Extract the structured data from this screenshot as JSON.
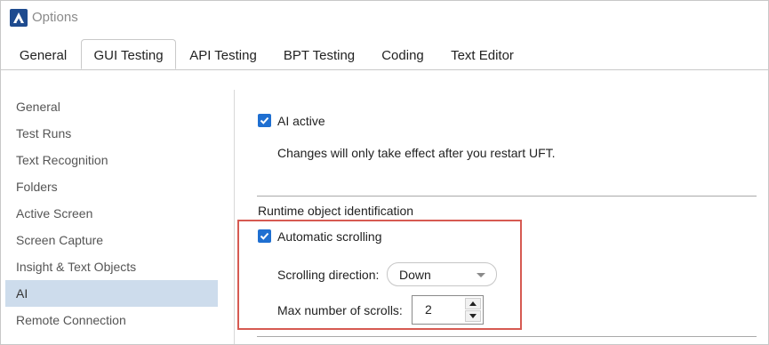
{
  "window": {
    "title": "Options",
    "icon": "uft-logo-icon"
  },
  "tabs": [
    {
      "label": "General"
    },
    {
      "label": "GUI Testing",
      "active": true
    },
    {
      "label": "API Testing"
    },
    {
      "label": "BPT Testing"
    },
    {
      "label": "Coding"
    },
    {
      "label": "Text Editor"
    }
  ],
  "nav": {
    "items": [
      {
        "label": "General"
      },
      {
        "label": "Test Runs"
      },
      {
        "label": "Text Recognition"
      },
      {
        "label": "Folders"
      },
      {
        "label": "Active Screen"
      },
      {
        "label": "Screen Capture"
      },
      {
        "label": "Insight & Text Objects"
      },
      {
        "label": "AI",
        "selected": true
      },
      {
        "label": "Remote Connection"
      }
    ]
  },
  "ai": {
    "active_label": "AI active",
    "active_checked": true,
    "restart_note": "Changes will only take effect after you restart UFT."
  },
  "runtime": {
    "section_title": "Runtime object identification",
    "auto_scroll_label": "Automatic scrolling",
    "auto_scroll_checked": true,
    "direction_label": "Scrolling direction:",
    "direction_value": "Down",
    "max_scrolls_label": "Max number of scrolls:",
    "max_scrolls_value": "2"
  },
  "colors": {
    "accent": "#1f6fd1",
    "selection": "#cddcec",
    "highlight_border": "#d65a52"
  }
}
